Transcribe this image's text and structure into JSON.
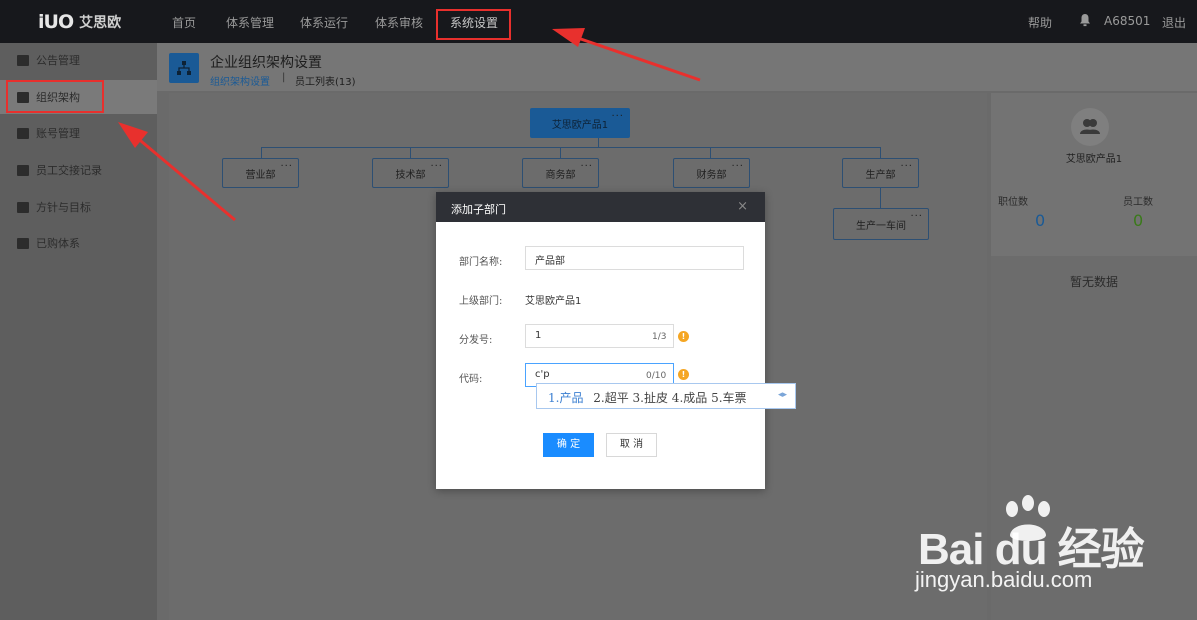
{
  "header": {
    "logo_mark": "iUO",
    "logo_text": "艾思欧",
    "nav": [
      "首页",
      "体系管理",
      "体系运行",
      "体系审核",
      "系统设置"
    ],
    "help": "帮助",
    "user": "A68501",
    "logout": "退出"
  },
  "sidebar": {
    "items": [
      {
        "label": "公告管理"
      },
      {
        "label": "组织架构"
      },
      {
        "label": "账号管理"
      },
      {
        "label": "员工交接记录"
      },
      {
        "label": "方针与目标"
      },
      {
        "label": "已购体系"
      }
    ]
  },
  "page": {
    "title": "企业组织架构设置",
    "crumb_active": "组织架构设置",
    "crumb_sep": "|",
    "crumb_other": "员工列表(13)"
  },
  "org": {
    "root": "艾思欧产品1",
    "departments": [
      "营业部",
      "技术部",
      "商务部",
      "财务部",
      "生产部"
    ],
    "sub": "生产一车间",
    "dots": "···"
  },
  "right_panel": {
    "name": "艾思欧产品1",
    "positions_label": "职位数",
    "positions_value": "0",
    "staff_label": "员工数",
    "staff_value": "0",
    "empty": "暂无数据"
  },
  "modal": {
    "title": "添加子部门",
    "close": "×",
    "dept_name_label": "部门名称:",
    "dept_name_value": "产品部",
    "parent_label": "上级部门:",
    "parent_value": "艾思欧产品1",
    "order_label": "分发号:",
    "order_value": "1",
    "order_count": "1/3",
    "code_label": "代码:",
    "code_value": "c'p",
    "code_count": "0/10",
    "ok": "确 定",
    "cancel": "取 消",
    "info": "!"
  },
  "ime": {
    "selected": "1.产品",
    "candidates": "2.超平  3.扯皮  4.成品  5.车票",
    "arrows": "◂▸"
  },
  "watermark": {
    "brand": "Bai du 经验",
    "url": "jingyan.baidu.com"
  },
  "colors": {
    "accent": "#1a8cff",
    "annotation": "#e8302d",
    "warning": "#f5a623"
  }
}
